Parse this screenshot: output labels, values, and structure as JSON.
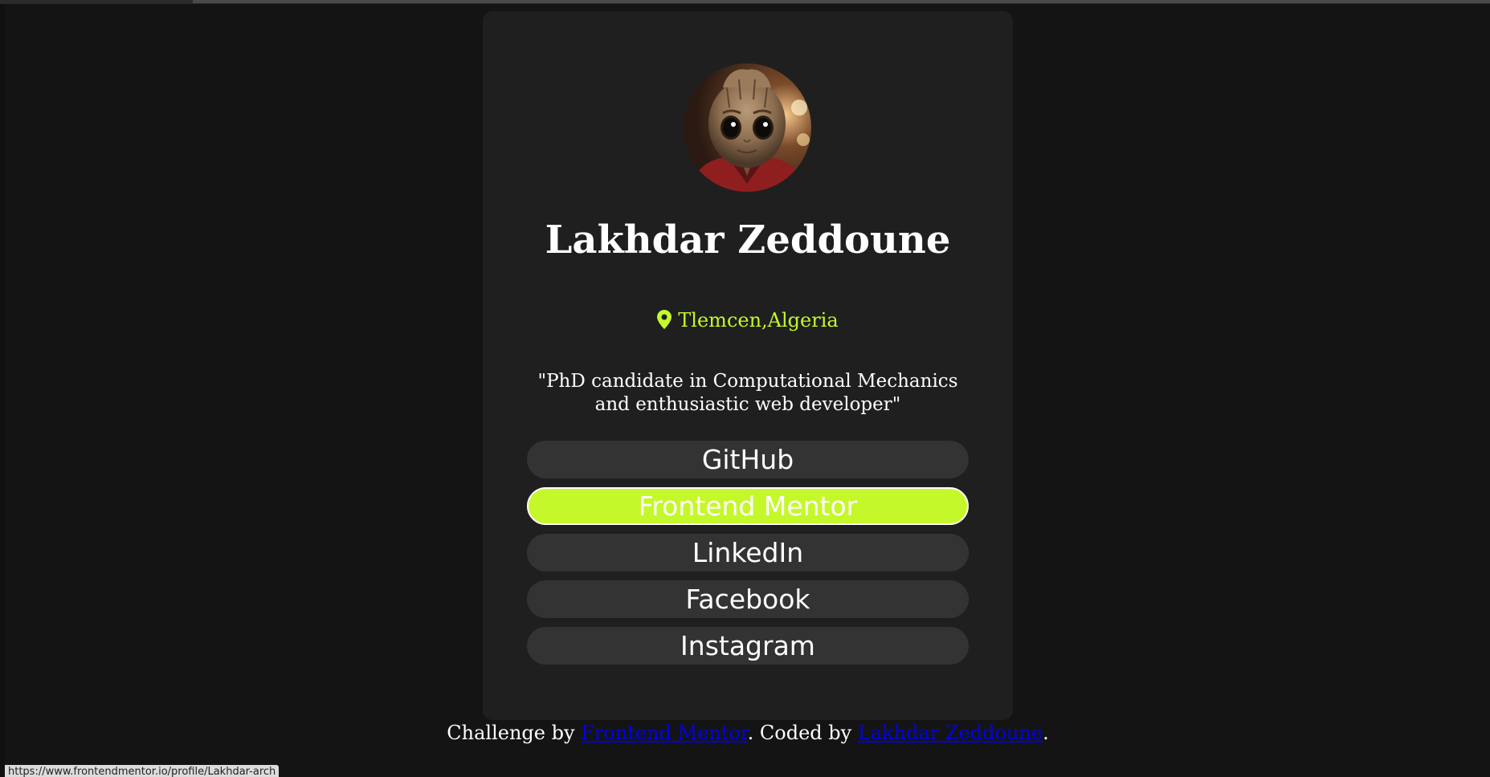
{
  "profile": {
    "name": "Lakhdar Zeddoune",
    "location": "Tlemcen,Algeria",
    "bio": "\"PhD candidate in Computational Mechanics and enthusiastic web developer\"",
    "avatar_icon": "groot-avatar"
  },
  "links": [
    {
      "label": "GitHub",
      "active": false
    },
    {
      "label": "Frontend Mentor",
      "active": true
    },
    {
      "label": "LinkedIn",
      "active": false
    },
    {
      "label": "Facebook",
      "active": false
    },
    {
      "label": "Instagram",
      "active": false
    }
  ],
  "attribution": {
    "prefix": "Challenge by ",
    "challenge_link": "Frontend Mentor",
    "middle": ". Coded by ",
    "author_link": "Lakhdar Zeddoune",
    "suffix": "."
  },
  "status_bar": {
    "url": "https://www.frontendmentor.io/profile/Lakhdar-arch"
  },
  "colors": {
    "page_background": "#141414",
    "card_background": "#1f1f1f",
    "button_background": "#333333",
    "accent": "#c5f82a",
    "link": "#0000ee"
  }
}
